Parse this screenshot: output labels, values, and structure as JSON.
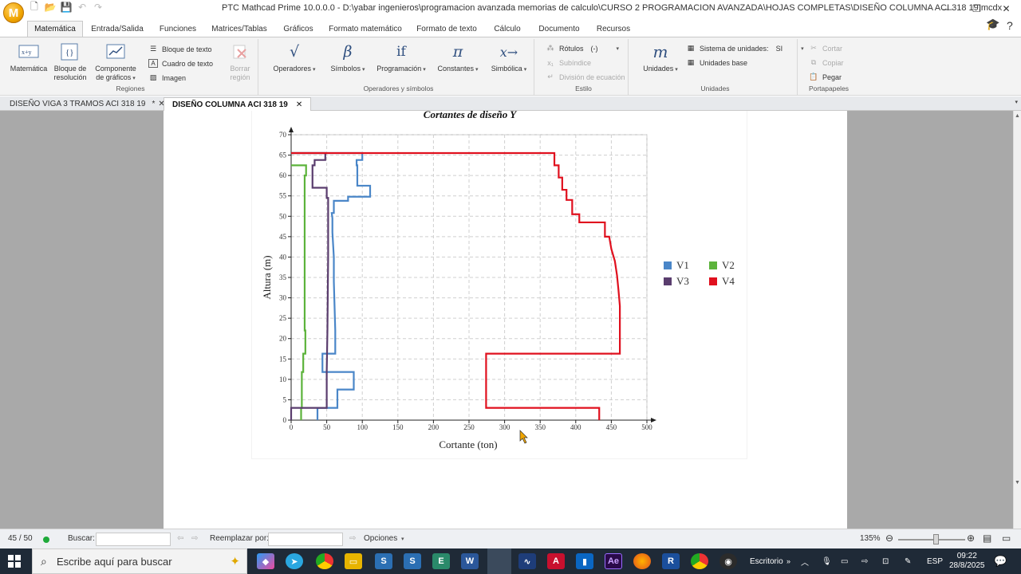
{
  "window": {
    "title": "PTC Mathcad Prime 10.0.0.0 - D:\\yabar ingenieros\\programacion avanzada memorias de calculo\\CURSO 2 PROGRAMACION AVANZADA\\HOJAS COMPLETAS\\DISEÑO COLUMNA ACI 318 19.mcdx",
    "app_logo": "M"
  },
  "ribbon_tabs": [
    "Matemática",
    "Entrada/Salida",
    "Funciones",
    "Matrices/Tablas",
    "Gráficos",
    "Formato matemático",
    "Formato de texto",
    "Cálculo",
    "Documento",
    "Recursos"
  ],
  "ribbon": {
    "regiones": {
      "label": "Regiones",
      "matematica": "Matemática",
      "bloque_resolucion": [
        "Bloque de",
        "resolución"
      ],
      "componente_graficos": [
        "Componente",
        "de gráficos"
      ],
      "bloque_texto": "Bloque de texto",
      "cuadro_texto": "Cuadro de texto",
      "imagen": "Imagen",
      "borrar_region": [
        "Borrar",
        "región"
      ]
    },
    "operadores": {
      "label": "Operadores y símbolos",
      "operadores": "Operadores",
      "simbolos": "Símbolos",
      "programacion": "Programación",
      "constantes": "Constantes",
      "simbolica": "Simbólica",
      "if_glyph": "if",
      "pi_glyph": "π",
      "beta_glyph": "β",
      "sym_glyph": "x→"
    },
    "estilo": {
      "label": "Estilo",
      "rotulos": "Rótulos",
      "rotulos_value": "(-)",
      "subindice": "Subíndice",
      "division": "División de ecuación"
    },
    "unidades": {
      "label": "Unidades",
      "unidades": "Unidades",
      "unit_glyph": "m",
      "sistema": "Sistema de unidades:",
      "sistema_value": "SI",
      "unidades_base": "Unidades base"
    },
    "portapapeles": {
      "label": "Portapapeles",
      "cortar": "Cortar",
      "copiar": "Copiar",
      "pegar": "Pegar"
    }
  },
  "doc_tabs": [
    {
      "label": "DISEÑO VIGA 3 TRAMOS ACI 318 19",
      "marker": "*",
      "close": "✕"
    },
    {
      "label": "DISEÑO COLUMNA ACI 318 19",
      "close": "✕"
    }
  ],
  "chart_data": {
    "type": "line",
    "title": "Cortantes de diseño Y",
    "xlabel": "Cortante (ton)",
    "ylabel": "Altura (m)",
    "xlim": [
      0,
      500
    ],
    "ylim": [
      0,
      70
    ],
    "xticks": [
      0,
      50,
      100,
      150,
      200,
      250,
      300,
      350,
      400,
      450,
      500
    ],
    "yticks": [
      0,
      5,
      10,
      15,
      20,
      25,
      30,
      35,
      40,
      45,
      50,
      55,
      60,
      65,
      70
    ],
    "grid": true,
    "legend": "right",
    "series": [
      {
        "name": "V1",
        "color": "#4a86c8",
        "x": [
          37,
          37,
          65,
          65,
          88,
          88,
          44,
          44,
          62,
          62,
          61,
          60,
          60,
          58,
          58,
          57,
          60,
          60,
          80,
          80,
          111,
          111,
          93,
          93,
          92,
          92,
          100,
          100,
          0
        ],
        "y": [
          0,
          3,
          3,
          7.5,
          7.5,
          11.8,
          11.8,
          16.3,
          16.3,
          22,
          28,
          34,
          40,
          46,
          49.5,
          50.8,
          50.8,
          53.8,
          53.8,
          54.8,
          54.8,
          57.5,
          57.5,
          62.5,
          62.5,
          63.8,
          63.8,
          65.5,
          65.5
        ]
      },
      {
        "name": "V2",
        "color": "#5cb33b",
        "x": [
          14,
          14,
          15,
          15,
          17,
          17,
          20,
          20,
          19,
          19,
          21,
          21,
          0
        ],
        "y": [
          0,
          3,
          3,
          11.8,
          11.8,
          16.3,
          16.3,
          22,
          22,
          60,
          60,
          62.5,
          62.5
        ]
      },
      {
        "name": "V3",
        "color": "#5a3d6e",
        "x": [
          0,
          0,
          50,
          50,
          51,
          52,
          52,
          50,
          50,
          30,
          30,
          33,
          33,
          48,
          48,
          0
        ],
        "y": [
          0,
          3,
          3,
          11.8,
          22,
          40,
          54.5,
          54.5,
          57,
          57,
          62.5,
          62.5,
          63.8,
          63.8,
          65.5,
          65.5
        ]
      },
      {
        "name": "V4",
        "color": "#e0101e",
        "x": [
          433,
          433,
          274,
          274,
          462,
          462,
          460,
          458,
          455,
          450,
          447,
          441,
          441,
          405,
          405,
          395,
          395,
          387,
          387,
          381,
          381,
          376,
          376,
          370,
          370,
          0
        ],
        "y": [
          0,
          3,
          3,
          16.3,
          16.3,
          28,
          32,
          35.5,
          39,
          42,
          45,
          45,
          48.5,
          48.5,
          50.5,
          50.5,
          54,
          54,
          56.5,
          56.5,
          59.5,
          59.5,
          62.5,
          62.5,
          65.5,
          65.5
        ]
      }
    ]
  },
  "statusbar": {
    "page": "45 / 50",
    "buscar": "Buscar:",
    "reemplazar": "Reemplazar por:",
    "opciones": "Opciones",
    "zoom": "135%"
  },
  "taskbar": {
    "search_placeholder": "Escribe aquí para buscar",
    "escritorio": "Escritorio",
    "language": "ESP",
    "time": "09:22",
    "date": "28/8/2025"
  },
  "colors": {
    "workspace": "#a9a9a9",
    "taskbar": "#1f2a37",
    "accent": "#2f4f7f"
  }
}
